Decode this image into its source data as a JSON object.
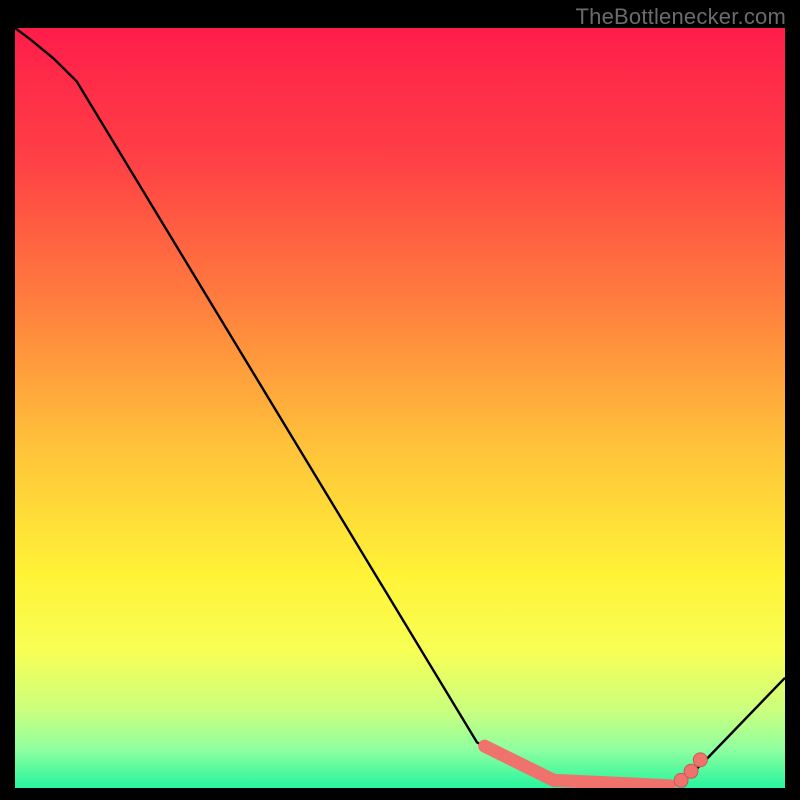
{
  "watermark": "TheBottlenecker.com",
  "colors": {
    "gradient_stops": [
      {
        "offset": 0.0,
        "color": "#ff1d4a"
      },
      {
        "offset": 0.18,
        "color": "#ff4245"
      },
      {
        "offset": 0.35,
        "color": "#ff7a3e"
      },
      {
        "offset": 0.55,
        "color": "#ffc23a"
      },
      {
        "offset": 0.72,
        "color": "#fff337"
      },
      {
        "offset": 0.82,
        "color": "#f7ff55"
      },
      {
        "offset": 0.9,
        "color": "#c9ff80"
      },
      {
        "offset": 0.95,
        "color": "#8effa0"
      },
      {
        "offset": 1.0,
        "color": "#26f59d"
      }
    ],
    "curve": "#000000",
    "dot_fill": "#ef726d",
    "dot_stroke": "#c85a57"
  },
  "chart_data": {
    "type": "line",
    "title": "",
    "xlabel": "",
    "ylabel": "",
    "x": [
      0.0,
      0.02,
      0.05,
      0.08,
      0.6,
      0.67,
      0.7,
      0.72,
      0.74,
      0.76,
      0.78,
      0.8,
      0.82,
      0.84,
      0.86,
      0.88,
      0.9,
      1.0
    ],
    "y": [
      1.0,
      0.985,
      0.96,
      0.93,
      0.06,
      0.02,
      0.012,
      0.008,
      0.005,
      0.003,
      0.002,
      0.002,
      0.002,
      0.003,
      0.006,
      0.02,
      0.04,
      0.145
    ],
    "xlim": [
      0,
      1
    ],
    "ylim": [
      0,
      1
    ],
    "marker_segments": [
      {
        "x0": 0.61,
        "y0": 0.055,
        "x1": 0.7,
        "y1": 0.01
      },
      {
        "x0": 0.7,
        "y0": 0.01,
        "x1": 0.85,
        "y1": 0.003
      }
    ],
    "marker_dots": [
      {
        "x": 0.865,
        "y": 0.01
      },
      {
        "x": 0.878,
        "y": 0.022
      },
      {
        "x": 0.89,
        "y": 0.037
      }
    ]
  }
}
